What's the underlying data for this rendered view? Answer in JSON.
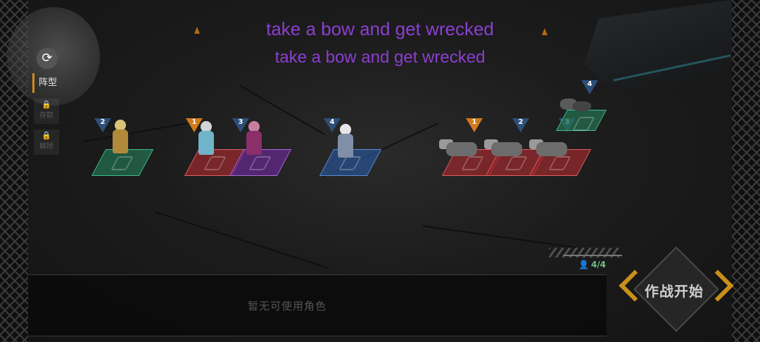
{
  "overlay": {
    "line1": "take a bow and get wrecked",
    "line2": "take a bow and get wrecked"
  },
  "menu": {
    "switch_icon": "swap-icon",
    "formation_tab": "阵型",
    "save_label": "存取",
    "release_label": "解除",
    "lock_icon": "lock-icon"
  },
  "board": {
    "ally_units": [
      {
        "slot": "2",
        "tile": "green",
        "sprite": "gold"
      },
      {
        "slot": "1",
        "tile": "red",
        "sprite": "silver"
      },
      {
        "slot": "3",
        "tile": "purple",
        "sprite": "crimson"
      },
      {
        "slot": "4",
        "tile": "blue",
        "sprite": "white"
      }
    ],
    "enemy_units": [
      {
        "slot": "1",
        "tile": "red",
        "sprite": "mech"
      },
      {
        "slot": "2",
        "tile": "red",
        "sprite": "mech"
      },
      {
        "slot": "3",
        "tile": "red",
        "sprite": "mech"
      },
      {
        "slot": "4",
        "tile": "green",
        "sprite": "drone"
      }
    ]
  },
  "bottom": {
    "empty_message": "暂无可使用角色",
    "deploy_count": "4/4",
    "person_icon": "person-icon"
  },
  "start_button": {
    "label": "作战开始"
  },
  "colors": {
    "overlay_text": "#8b3fd0",
    "accent_orange": "#c98f1a",
    "count_green": "#6fbf80"
  }
}
